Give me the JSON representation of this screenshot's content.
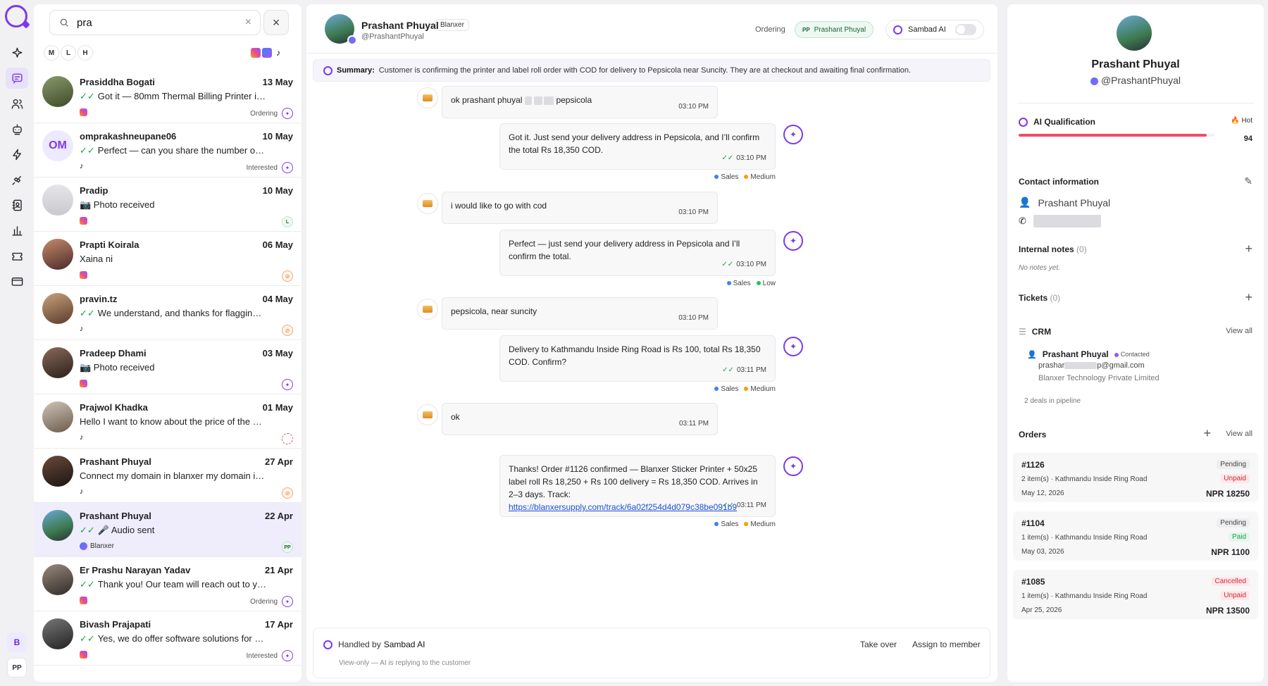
{
  "search": {
    "value": "pra"
  },
  "filters": [
    "M",
    "L",
    "H"
  ],
  "rail": {
    "badge_b": "B",
    "badge_pp": "PP"
  },
  "conversations": [
    {
      "name": "Prasiddha Bogati",
      "date": "13 May",
      "preview": "Got it — 80mm Thermal Billing Printer is Rs 10,5...",
      "check": true,
      "platform": "instagram",
      "tag": "Ordering",
      "status": "ai"
    },
    {
      "name": "omprakashneupane06",
      "date": "10 May",
      "preview": "Perfect — can you share the number our team c...",
      "check": true,
      "platform": "tiktok",
      "tag": "Interested",
      "status": "ai",
      "initials": "OM"
    },
    {
      "name": "Pradip",
      "date": "10 May",
      "preview": "📷 Photo received",
      "check": false,
      "platform": "instagram",
      "tag": "",
      "status": "L"
    },
    {
      "name": "Prapti Koirala",
      "date": "06 May",
      "preview": "Xaina ni",
      "check": false,
      "platform": "instagram",
      "tag": "",
      "status": "off"
    },
    {
      "name": "pravin.tz",
      "date": "04 May",
      "preview": "We understand, and thanks for flagging that. Ou...",
      "check": true,
      "platform": "tiktok",
      "tag": "",
      "status": "off"
    },
    {
      "name": "Pradeep Dhami",
      "date": "03 May",
      "preview": "📷 Photo received",
      "check": false,
      "platform": "instagram",
      "tag": "",
      "status": "ai"
    },
    {
      "name": "Prajwol Khadka",
      "date": "01 May",
      "preview": "Hello I want to know about the price of the printer",
      "check": false,
      "platform": "tiktok",
      "tag": "",
      "status": "wait"
    },
    {
      "name": "Prashant Phuyal",
      "date": "27 Apr",
      "preview": "Connect my domain in blanxer my domain is mystor...",
      "check": false,
      "platform": "tiktok",
      "tag": "",
      "status": "off"
    },
    {
      "name": "Prashant Phuyal",
      "date": "22 Apr",
      "preview": "🎤 Audio sent",
      "check": true,
      "platform": "messenger",
      "platform_label": "Blanxer",
      "tag": "",
      "status": "PP",
      "selected": true
    },
    {
      "name": "Er Prashu Narayan Yadav",
      "date": "21 Apr",
      "preview": "Thank you! Our team will reach out to you shortl...",
      "check": true,
      "platform": "instagram",
      "tag": "Ordering",
      "status": "ai"
    },
    {
      "name": "Bivash Prajapati",
      "date": "17 Apr",
      "preview": "Yes, we do offer software solutions for cafes as ...",
      "check": true,
      "platform": "instagram",
      "tag": "Interested",
      "status": "ai"
    }
  ],
  "header": {
    "name": "Prashant Phuyal",
    "badge": "Blanxer",
    "handle": "@PrashantPhuyal",
    "stage": "Ordering",
    "assignee_initials": "PP",
    "assignee": "Prashant Phuyal",
    "ai_label": "Sambad AI"
  },
  "summary": {
    "label": "Summary:",
    "text": "Customer is confirming the printer and label roll order with COD for delivery to Pepsicola near Suncity. They are at checkout and awaiting final confirmation."
  },
  "messages": [
    {
      "from": "customer",
      "text_before": "ok prashant phuyal",
      "text_after": "pepsicola",
      "time": "03:10 PM"
    },
    {
      "from": "bot",
      "text": "Got it. Just send your delivery address in Pepsicola, and I’ll confirm the total Rs 18,350 COD.",
      "time": "03:10 PM",
      "tags": [
        {
          "label": "Sales",
          "color": "#3b82f6"
        },
        {
          "label": "Medium",
          "color": "#f59e0b"
        }
      ]
    },
    {
      "from": "customer",
      "text": "i would like to go with cod",
      "time": "03:10 PM"
    },
    {
      "from": "bot",
      "text": "Perfect — just send your delivery address in Pepsicola and I’ll confirm the total.",
      "time": "03:10 PM",
      "tags": [
        {
          "label": "Sales",
          "color": "#3b82f6"
        },
        {
          "label": "Low",
          "color": "#22c55e"
        }
      ]
    },
    {
      "from": "customer",
      "text": "pepsicola, near suncity",
      "time": "03:10 PM"
    },
    {
      "from": "bot",
      "text": "Delivery to Kathmandu Inside Ring Road is Rs 100, total Rs 18,350 COD. Confirm?",
      "time": "03:11 PM",
      "tags": [
        {
          "label": "Sales",
          "color": "#3b82f6"
        },
        {
          "label": "Medium",
          "color": "#f59e0b"
        }
      ]
    },
    {
      "from": "customer",
      "text": "ok",
      "time": "03:11 PM"
    },
    {
      "from": "bot",
      "text": "Thanks! Order #1126 confirmed — Blanxer Sticker Printer + 50x25 label roll Rs 18,250 + Rs 100 delivery = Rs 18,350 COD. Arrives in 2–3 days.",
      "track_label": "Track:",
      "link": "https://blanxersupply.com/track/6a02f254d4d079c38be091b9",
      "time": "03:11 PM",
      "tags": [
        {
          "label": "Sales",
          "color": "#3b82f6"
        },
        {
          "label": "Medium",
          "color": "#f59e0b"
        }
      ]
    }
  ],
  "footer": {
    "handled_prefix": "Handled by",
    "handled_by": "Sambad AI",
    "note": "View-only — AI is replying to the customer",
    "take_over": "Take over",
    "assign": "Assign to member"
  },
  "profile": {
    "name": "Prashant Phuyal",
    "handle": "@PrashantPhuyal",
    "ai_qualification": "AI Qualification",
    "temperature": "Hot",
    "score": "94",
    "score_fraction": 0.96,
    "contact_title": "Contact information",
    "contact_name": "Prashant Phuyal",
    "notes_title": "Internal notes",
    "notes_count": "(0)",
    "notes_empty": "No notes yet.",
    "tickets_title": "Tickets",
    "tickets_count": "(0)",
    "crm_title": "CRM",
    "crm_view_all": "View all",
    "crm_name": "Prashant Phuyal",
    "crm_status": "Contacted",
    "crm_email_start": "prashar",
    "crm_email_end": "p@gmail.com",
    "crm_company": "Blanxer Technology Private Limited",
    "crm_deals": "2 deals in pipeline",
    "orders_title": "Orders",
    "orders_view_all": "View all"
  },
  "orders": [
    {
      "id": "#1126",
      "items": "2 item(s) · Kathmandu Inside Ring Road",
      "date": "May 12, 2026",
      "status": "Pending",
      "payment": "Unpaid",
      "amount": "NPR 18250"
    },
    {
      "id": "#1104",
      "items": "1 item(s) · Kathmandu Inside Ring Road",
      "date": "May 03, 2026",
      "status": "Pending",
      "payment": "Paid",
      "amount": "NPR 1100"
    },
    {
      "id": "#1085",
      "items": "1 item(s) · Kathmandu Inside Ring Road",
      "date": "Apr 25, 2026",
      "status": "Cancelled",
      "payment": "Unpaid",
      "amount": "NPR 13500"
    }
  ]
}
